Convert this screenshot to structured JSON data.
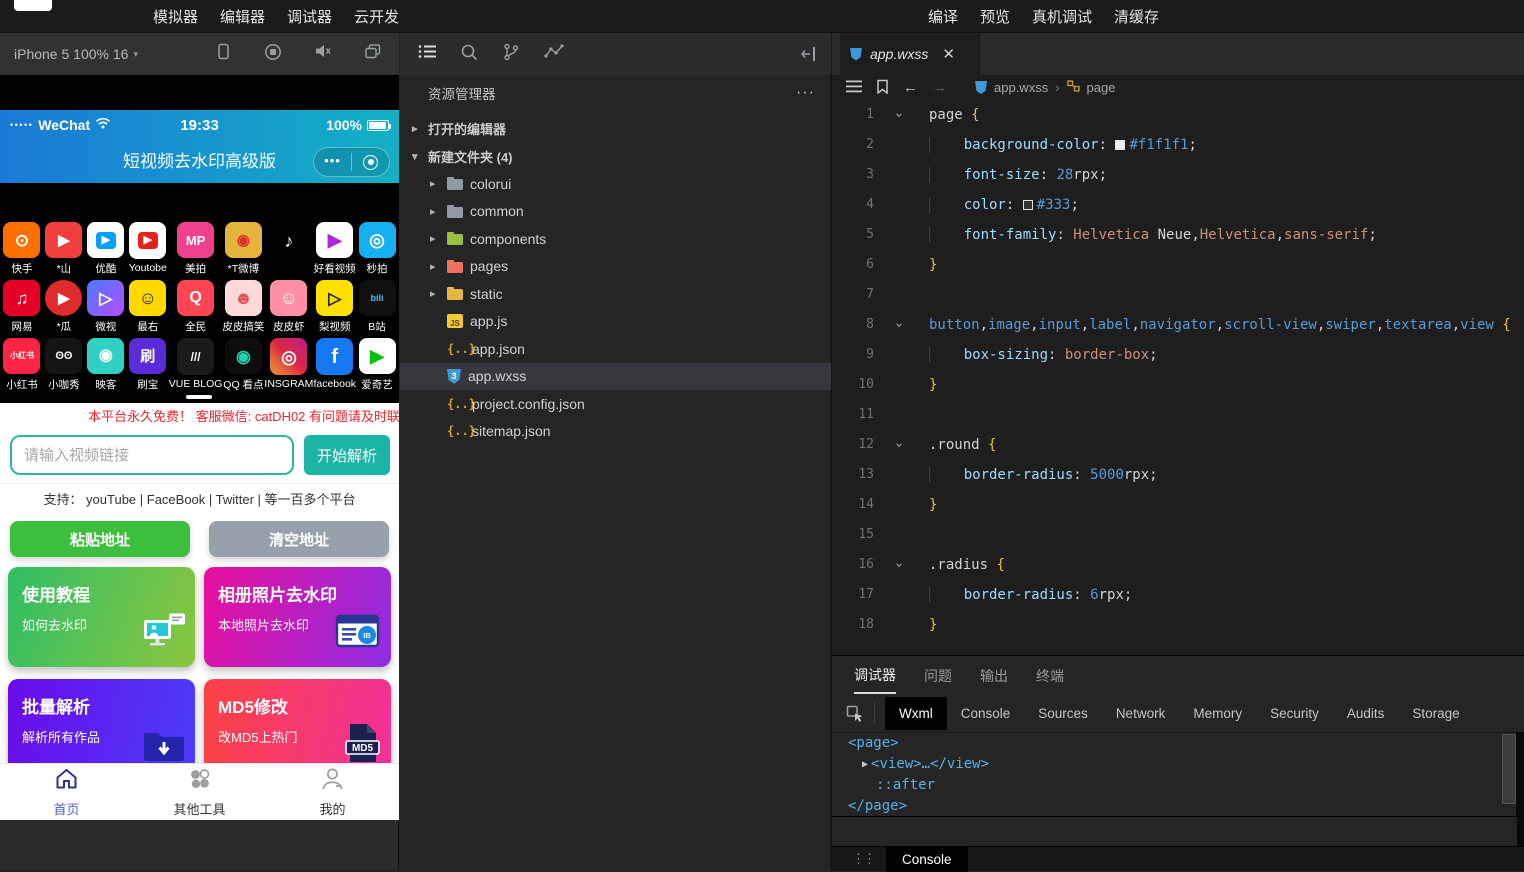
{
  "menubar": {
    "left": [
      "模拟器",
      "编辑器",
      "调试器",
      "云开发"
    ],
    "right": [
      "编译",
      "预览",
      "真机调试",
      "清缓存"
    ]
  },
  "sim": {
    "device": "iPhone 5 100% 16",
    "caret": "▾"
  },
  "phone": {
    "status": {
      "signal": "•••••",
      "carrier": "WeChat",
      "time": "19:33",
      "battery": "100%"
    },
    "title": "短视频去水印高级版",
    "capsule_dots": "•••",
    "icon_grid": [
      [
        {
          "label": "快手",
          "bg": "#ff7000",
          "glyph": "⊙",
          "fg": "#fff",
          "fs": 17
        },
        {
          "label": "*山",
          "bg": "#f23d3d",
          "glyph": "▶",
          "fg": "#fff"
        },
        {
          "label": "优酷",
          "bg": "#ffffff",
          "glyph": "▶",
          "fg": "#fff",
          "chip": "#0aa0f5"
        },
        {
          "label": "Youtobe",
          "bg": "#ffffff",
          "glyph": "▶",
          "fg": "#fff",
          "chip": "#e62117"
        },
        {
          "label": "美拍",
          "bg": "#f0418f",
          "glyph": "MP",
          "fg": "#fff",
          "fs": 13
        },
        {
          "label": "*T微博",
          "bg": "#e6b43c",
          "glyph": "◉",
          "fg": "#d93127"
        },
        {
          "label": "",
          "bg": "#000000",
          "glyph": "♪",
          "fg": "#fff",
          "fs": 18
        },
        {
          "label": "好看视频",
          "bg": "#ffffff",
          "glyph": "▶",
          "fg": "#b026d9",
          "fs": 18
        },
        {
          "label": "秒拍",
          "bg": "#16b0f0",
          "glyph": "◎",
          "fg": "#fff",
          "fs": 18
        }
      ],
      [
        {
          "label": "网易",
          "bg": "#e60026",
          "glyph": "♫",
          "fg": "#fff",
          "fs": 17
        },
        {
          "label": "*瓜",
          "bg": "#df2b2b",
          "glyph": "▶",
          "fg": "#fff",
          "round": true
        },
        {
          "label": "微视",
          "bg": "linear-gradient(135deg,#4a7bff,#b44cff)",
          "glyph": "▷",
          "fg": "#fff",
          "fs": 17
        },
        {
          "label": "最右",
          "bg": "#ffd900",
          "glyph": "☺",
          "fg": "#222",
          "fs": 18
        },
        {
          "label": "全民",
          "bg": "#ff4454",
          "glyph": "Q",
          "fg": "#fff",
          "fs": 16
        },
        {
          "label": "皮皮搞笑",
          "bg": "#ffd9d9",
          "glyph": "☻",
          "fg": "#e05656",
          "fs": 18
        },
        {
          "label": "皮皮虾",
          "bg": "#ff8fa5",
          "glyph": "☺",
          "fg": "#fff",
          "fs": 18
        },
        {
          "label": "梨视频",
          "bg": "#ffe000",
          "glyph": "▷",
          "fg": "#222",
          "fs": 17
        },
        {
          "label": "B站",
          "bg": "#101010",
          "glyph": "bili",
          "fg": "#4cc4f5",
          "fs": 9
        }
      ],
      [
        {
          "label": "小红书",
          "bg": "#ff2442",
          "glyph": "小红书",
          "fg": "#fff",
          "fs": 8
        },
        {
          "label": "小咖秀",
          "bg": "#141414",
          "glyph": "ʘʘ",
          "fg": "#fff",
          "fs": 11
        },
        {
          "label": "映客",
          "bg": "#2fd0c5",
          "glyph": "◉",
          "fg": "#fff",
          "fs": 16
        },
        {
          "label": "刷宝",
          "bg": "#5a2bd8",
          "glyph": "刷",
          "fg": "#fff",
          "fs": 15
        },
        {
          "label": "VUE BLOG",
          "bg": "#1a1a1a",
          "glyph": "///",
          "fg": "#fff",
          "fs": 12
        },
        {
          "label": "QQ 看点",
          "bg": "#0d0d0d",
          "glyph": "◉",
          "fg": "#1fd2b5",
          "fs": 17
        },
        {
          "label": "INSGRAM",
          "bg": "linear-gradient(45deg,#f09433,#e6683c 25%,#dc2743 50%,#cc2366 75%,#bc1888)",
          "glyph": "◎",
          "fg": "#fff",
          "fs": 18
        },
        {
          "label": "facebook",
          "bg": "#1877f2",
          "glyph": "f",
          "fg": "#fff",
          "fs": 20
        },
        {
          "label": "爱奇艺",
          "bg": "#ffffff",
          "glyph": "▶",
          "fg": "#00c300",
          "fs": 18
        }
      ]
    ],
    "notice": "本平台永久免费！ 客服微信: catDH02 有问题请及时联",
    "input_placeholder": "请输入视频链接",
    "parse_btn": "开始解析",
    "support": "支持：  youTube | FaceBook | Twitter | 等一百多个平台",
    "paste_btn": "粘贴地址",
    "clear_btn": "清空地址",
    "paste_btn_color": "#3dbf3d",
    "clear_btn_color": "#98a1ab",
    "cards": [
      {
        "title": "使用教程",
        "sub": "如何去水印",
        "bg": "linear-gradient(110deg,#2fbe66,#8cc63f)",
        "icon": "tutorial"
      },
      {
        "title": "相册照片去水印",
        "sub": "本地照片去水印",
        "bg": "linear-gradient(110deg,#e90f9d,#8e2de2)",
        "icon": "album"
      },
      {
        "title": "批量解析",
        "sub": "解析所有作品",
        "bg": "linear-gradient(100deg,#6a0be8,#4b3dfb)",
        "icon": "batch"
      },
      {
        "title": "MD5修改",
        "sub": "改MD5上热门",
        "bg": "linear-gradient(100deg,#fb4242,#f2309b)",
        "icon": "md5"
      }
    ],
    "tabbar": [
      {
        "label": "首页",
        "icon": "home",
        "active": true
      },
      {
        "label": "其他工具",
        "icon": "tools",
        "active": false
      },
      {
        "label": "我的",
        "icon": "person",
        "active": false
      }
    ]
  },
  "explorer": {
    "title": "资源管理器",
    "menu": "···",
    "sections": [
      {
        "label": "打开的编辑器",
        "expanded": false
      },
      {
        "label": "新建文件夹 (4)",
        "expanded": true
      }
    ],
    "files": [
      {
        "name": "colorui",
        "type": "folder",
        "color": "#8f9aa6"
      },
      {
        "name": "common",
        "type": "folder",
        "color": "#8f9aa6"
      },
      {
        "name": "components",
        "type": "folder",
        "color": "#9bbf3b"
      },
      {
        "name": "pages",
        "type": "folder",
        "color": "#ee6e5f"
      },
      {
        "name": "static",
        "type": "folder",
        "color": "#e5b640"
      },
      {
        "name": "app.js",
        "type": "js"
      },
      {
        "name": "app.json",
        "type": "json"
      },
      {
        "name": "app.wxss",
        "type": "wxss",
        "selected": true
      },
      {
        "name": "project.config.json",
        "type": "json"
      },
      {
        "name": "sitemap.json",
        "type": "json"
      }
    ]
  },
  "editor": {
    "tab": "app.wxss",
    "breadcrumb": {
      "file": "app.wxss",
      "rule": "page"
    },
    "lines": [
      {
        "n": 1,
        "f": 1,
        "t": [
          [
            "page ",
            "p"
          ],
          [
            "{",
            "b"
          ]
        ]
      },
      {
        "n": 2,
        "t": [
          [
            "    ",
            "g"
          ],
          [
            "background-color",
            "pr"
          ],
          [
            ": ",
            "p"
          ],
          [
            "#f1f1f1",
            "n",
            "sw"
          ],
          [
            ";",
            "p"
          ]
        ]
      },
      {
        "n": 3,
        "t": [
          [
            "    ",
            "g"
          ],
          [
            "font-size",
            "pr"
          ],
          [
            ": ",
            "p"
          ],
          [
            "28",
            "n"
          ],
          [
            "rpx",
            "p"
          ],
          [
            ";",
            "p"
          ]
        ]
      },
      {
        "n": 4,
        "t": [
          [
            "    ",
            "g"
          ],
          [
            "color",
            "pr"
          ],
          [
            ": ",
            "p"
          ],
          [
            "#333",
            "n",
            "sw"
          ],
          [
            ";",
            "p"
          ]
        ]
      },
      {
        "n": 5,
        "t": [
          [
            "    ",
            "g"
          ],
          [
            "font-family",
            "pr"
          ],
          [
            ": ",
            "p"
          ],
          [
            "Helvetica",
            "s"
          ],
          [
            " ",
            "p"
          ],
          [
            "Neue",
            "p"
          ],
          [
            ",",
            "p"
          ],
          [
            "Helvetica",
            "s"
          ],
          [
            ",",
            "p"
          ],
          [
            "sans-serif",
            "s"
          ],
          [
            ";",
            "p"
          ]
        ]
      },
      {
        "n": 6,
        "t": [
          [
            "}",
            "b"
          ]
        ]
      },
      {
        "n": 7,
        "t": []
      },
      {
        "n": 8,
        "f": 1,
        "t": [
          [
            "button",
            "e"
          ],
          [
            ",",
            "p"
          ],
          [
            "image",
            "e"
          ],
          [
            ",",
            "p"
          ],
          [
            "input",
            "e"
          ],
          [
            ",",
            "p"
          ],
          [
            "label",
            "e"
          ],
          [
            ",",
            "p"
          ],
          [
            "navigator",
            "e"
          ],
          [
            ",",
            "p"
          ],
          [
            "scroll-view",
            "e"
          ],
          [
            ",",
            "p"
          ],
          [
            "swiper",
            "e"
          ],
          [
            ",",
            "p"
          ],
          [
            "textarea",
            "e"
          ],
          [
            ",",
            "p"
          ],
          [
            "view",
            "e"
          ],
          [
            " ",
            "p"
          ],
          [
            "{",
            "b"
          ]
        ]
      },
      {
        "n": 9,
        "t": [
          [
            "    ",
            "g"
          ],
          [
            "box-sizing",
            "pr"
          ],
          [
            ": ",
            "p"
          ],
          [
            "border-box",
            "s"
          ],
          [
            ";",
            "p"
          ]
        ]
      },
      {
        "n": 10,
        "t": [
          [
            "}",
            "b"
          ]
        ]
      },
      {
        "n": 11,
        "t": []
      },
      {
        "n": 12,
        "f": 1,
        "t": [
          [
            ".round ",
            "p"
          ],
          [
            "{",
            "b"
          ]
        ]
      },
      {
        "n": 13,
        "t": [
          [
            "    ",
            "g"
          ],
          [
            "border-radius",
            "pr"
          ],
          [
            ": ",
            "p"
          ],
          [
            "5000",
            "n"
          ],
          [
            "rpx",
            "p"
          ],
          [
            ";",
            "p"
          ]
        ]
      },
      {
        "n": 14,
        "t": [
          [
            "}",
            "b"
          ]
        ]
      },
      {
        "n": 15,
        "t": []
      },
      {
        "n": 16,
        "f": 1,
        "t": [
          [
            ".radius ",
            "p"
          ],
          [
            "{",
            "b"
          ]
        ]
      },
      {
        "n": 17,
        "t": [
          [
            "    ",
            "g"
          ],
          [
            "border-radius",
            "pr"
          ],
          [
            ": ",
            "p"
          ],
          [
            "6",
            "n"
          ],
          [
            "rpx",
            "p"
          ],
          [
            ";",
            "p"
          ]
        ]
      },
      {
        "n": 18,
        "t": [
          [
            "}",
            "b"
          ]
        ]
      }
    ]
  },
  "debug": {
    "tabs": [
      {
        "label": "调试器",
        "active": true
      },
      {
        "label": "问题",
        "active": false
      },
      {
        "label": "输出",
        "active": false
      },
      {
        "label": "终端",
        "active": false
      }
    ],
    "subtabs": [
      {
        "label": "Wxml",
        "active": true
      },
      {
        "label": "Console",
        "active": false
      },
      {
        "label": "Sources",
        "active": false
      },
      {
        "label": "Network",
        "active": false
      },
      {
        "label": "Memory",
        "active": false
      },
      {
        "label": "Security",
        "active": false
      },
      {
        "label": "Audits",
        "active": false
      },
      {
        "label": "Storage",
        "active": false
      }
    ],
    "wxml": [
      {
        "text": "<page>",
        "indent": 0
      },
      {
        "text": "<view>…</view>",
        "indent": 1,
        "arrow": true
      },
      {
        "text": "::after",
        "indent": 2
      },
      {
        "text": "</page>",
        "indent": 0
      }
    ],
    "console_label": "Console"
  },
  "colors": {
    "accent_teal": "#1cb5a5",
    "header_gradient_left": "#1b79d6",
    "header_gradient_right": "#13b0c6",
    "notice_red": "#f5222d",
    "tab_active_blue": "#4f5ed7"
  }
}
